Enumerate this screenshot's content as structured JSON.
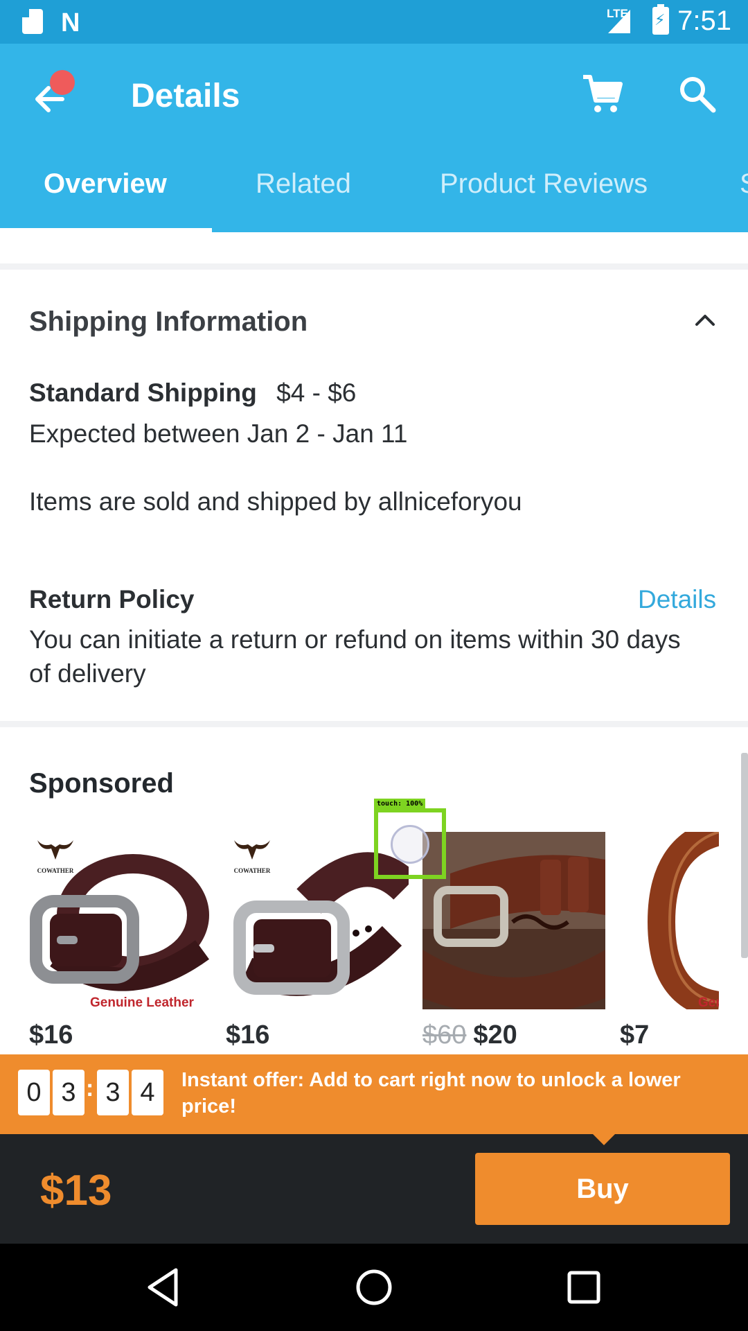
{
  "status_bar": {
    "time": "7:51",
    "network": "LTE"
  },
  "app_bar": {
    "title": "Details",
    "icons": [
      "back-arrow-icon",
      "cart-icon",
      "search-icon"
    ],
    "notification_dot_color": "#ef5b5b"
  },
  "tabs": [
    {
      "label": "Overview",
      "active": true
    },
    {
      "label": "Related",
      "active": false
    },
    {
      "label": "Product Reviews",
      "active": false
    },
    {
      "label": "S",
      "active": false
    }
  ],
  "shipping": {
    "title": "Shipping Information",
    "standard_label": "Standard Shipping",
    "standard_price": "$4 - $6",
    "expected": "Expected between Jan 2 - Jan 11",
    "sold_by": "Items are sold and shipped by allniceforyou"
  },
  "return_policy": {
    "title": "Return Policy",
    "details_link": "Details",
    "line1": "You can initiate a return or refund on items within 30 days",
    "line2": "of delivery"
  },
  "sponsored": {
    "title": "Sponsored",
    "items": [
      {
        "price": "$16",
        "brand": "COWATHER",
        "label": "Genuine Leather"
      },
      {
        "price": "$16",
        "brand": "COWATHER"
      },
      {
        "old_price": "$60",
        "price": "$20"
      },
      {
        "price": "$7",
        "label": "Ger"
      }
    ]
  },
  "touch_overlay": {
    "label": "touch: 100%"
  },
  "offer": {
    "countdown": [
      "0",
      "3",
      "3",
      "4"
    ],
    "separator": ":",
    "text": "Instant offer: Add to cart right now to unlock a lower price!"
  },
  "buy_bar": {
    "price": "$13",
    "buy_label": "Buy"
  },
  "colors": {
    "primary": "#33b5e8",
    "status_bar": "#1f9fd6",
    "accent": "#ef8c2d",
    "link": "#33a9dc",
    "dark_bar": "#202326"
  }
}
